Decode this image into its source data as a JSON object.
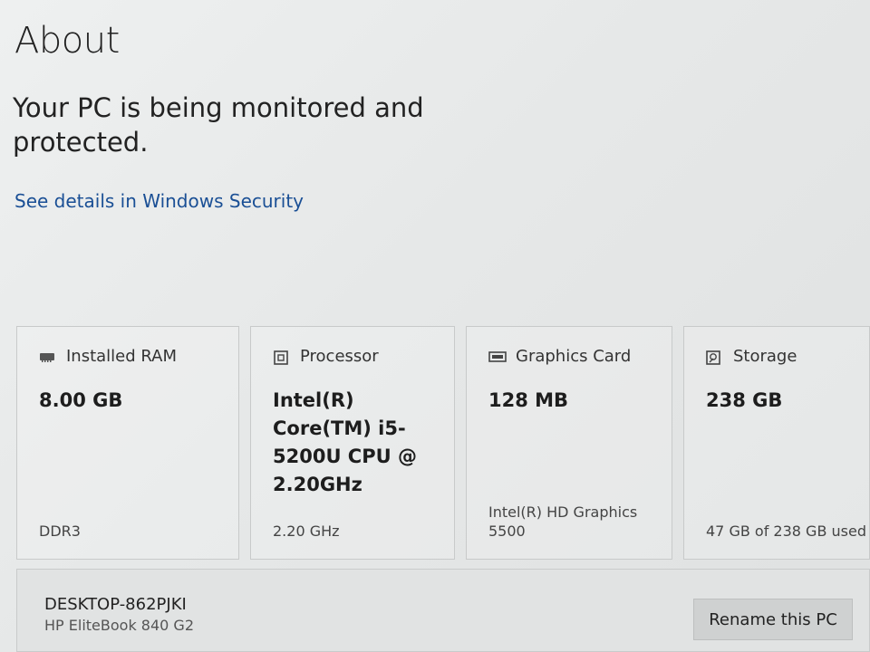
{
  "page": {
    "title": "About",
    "status_message": "Your PC is being monitored and protected.",
    "security_link": "See details in Windows Security"
  },
  "specs": [
    {
      "icon": "memory-icon",
      "label": "Installed RAM",
      "value": "8.00 GB",
      "detail": "DDR3"
    },
    {
      "icon": "processor-icon",
      "label": "Processor",
      "value": "Intel(R) Core(TM) i5-5200U CPU @ 2.20GHz",
      "detail": "2.20 GHz"
    },
    {
      "icon": "graphics-card-icon",
      "label": "Graphics Card",
      "value": "128 MB",
      "detail": "Intel(R) HD Graphics 5500"
    },
    {
      "icon": "storage-icon",
      "label": "Storage",
      "value": "238 GB",
      "detail": "47 GB of 238 GB used"
    }
  ],
  "device": {
    "name": "DESKTOP-862PJKI",
    "model": "HP EliteBook 840 G2",
    "rename_label": "Rename this PC"
  },
  "colors": {
    "link": "#1a4f95",
    "background": "#e6e8e8"
  }
}
